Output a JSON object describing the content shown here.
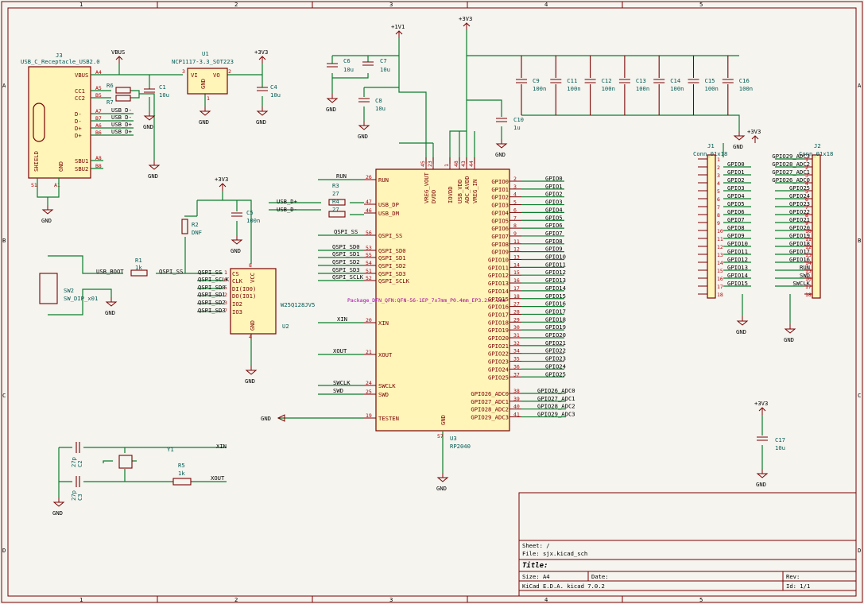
{
  "frame": {
    "cols": [
      "1",
      "2",
      "3",
      "4",
      "5"
    ],
    "rows": [
      "A",
      "B",
      "C",
      "D"
    ]
  },
  "title_block": {
    "sheet": "Sheet: /",
    "file": "File: sjx.kicad_sch",
    "title": "Title:",
    "size": "Size: A4",
    "date": "Date:",
    "rev": "Rev:",
    "tool": "KiCad E.D.A.  kicad 7.0.2",
    "id": "Id: 1/1"
  },
  "power": {
    "vbus": "VBUS",
    "v33": "+3V3",
    "v11": "+1V1",
    "gnd": "GND"
  },
  "j3": {
    "ref": "J3",
    "value": "USB_C_Receptacle_USB2.0",
    "pins_left": [
      "VBUS",
      "CC1",
      "CC2",
      "D-",
      "D-",
      "D+",
      "D+",
      "SBU1",
      "SBU2"
    ],
    "pins_num": [
      "A4",
      "A5",
      "B5",
      "A7",
      "B7",
      "A6",
      "B6",
      "A8",
      "B8"
    ],
    "shield": "SHIELD",
    "gnd": "GND",
    "s1": "S1",
    "a1": "A1",
    "net_dm": "USB_D-",
    "net_dp": "USB_D+"
  },
  "u1": {
    "ref": "U1",
    "value": "NCP1117-3.3_SOT223",
    "vi": "VI",
    "vo": "VO",
    "gnd": "GND",
    "p1": "1",
    "p2": "2",
    "p3": "3"
  },
  "parts": {
    "r6": "R6",
    "r7": "R7",
    "c1": "C1",
    "c1v": "10u",
    "c4": "C4",
    "c4v": "10u",
    "c6": "C6",
    "c6v": "10u",
    "c7": "C7",
    "c7v": "10u",
    "c8": "C8",
    "c8v": "10u",
    "c10": "C10",
    "c10v": "1u",
    "c5": "C5",
    "c5v": "100n",
    "r1": "R1",
    "r1v": "1k",
    "r2": "R2",
    "r2v": "DNF",
    "r3": "R3",
    "r3v": "27",
    "r4": "R4",
    "r4v": "27",
    "r5": "R5",
    "r5v": "1k",
    "sw2": "SW2",
    "sw2v": "SW_DIP_x01",
    "c2v": "27p",
    "c2": "C2",
    "c3v": "27p",
    "c3": "C3",
    "y1": "Y1",
    "c17": "C17",
    "c17v": "10u"
  },
  "caps_row": [
    {
      "ref": "C9",
      "val": "100n"
    },
    {
      "ref": "C11",
      "val": "100n"
    },
    {
      "ref": "C12",
      "val": "100n"
    },
    {
      "ref": "C13",
      "val": "100n"
    },
    {
      "ref": "C14",
      "val": "100n"
    },
    {
      "ref": "C15",
      "val": "100n"
    },
    {
      "ref": "C16",
      "val": "100n"
    }
  ],
  "u2": {
    "ref": "U2",
    "value": "W25Q128JV5",
    "pins": [
      "CS",
      "CLK",
      "DI(IO0)",
      "DO(IO1)",
      "IO2",
      "IO3"
    ],
    "nums": [
      "1",
      "6",
      "5",
      "2",
      "3",
      "7"
    ],
    "vcc": "VCC",
    "gnd": "GND",
    "p8": "8",
    "p4": "4",
    "nets": [
      "QSPI_SS",
      "QSPI_SCLK",
      "QSPI_SD0",
      "QSPI_SD1",
      "QSPI_SD2",
      "QSPI_SD3"
    ]
  },
  "u3": {
    "ref": "U3",
    "value": "RP2040",
    "footprint": "Package_DFN_QFN:QFN-56-1EP_7x7mm_P0.4mm_EP3.2x3.2mm",
    "left_pins": [
      {
        "n": "RUN",
        "num": "26"
      },
      {
        "n": "USB_DP",
        "num": "47"
      },
      {
        "n": "USB_DM",
        "num": "46"
      },
      {
        "n": "QSPI_SS",
        "num": "56"
      },
      {
        "n": "QSPI_SD0",
        "num": "53"
      },
      {
        "n": "QSPI_SD1",
        "num": "55"
      },
      {
        "n": "QSPI_SD2",
        "num": "54"
      },
      {
        "n": "QSPI_SD3",
        "num": "51"
      },
      {
        "n": "QSPI_SCLK",
        "num": "52"
      },
      {
        "n": "XIN",
        "num": "20"
      },
      {
        "n": "XOUT",
        "num": "21"
      },
      {
        "n": "SWCLK",
        "num": "24"
      },
      {
        "n": "SWD",
        "num": "25"
      },
      {
        "n": "TESTEN",
        "num": "19"
      }
    ],
    "top_pins": [
      {
        "n": "VREG_VOUT",
        "num": "45"
      },
      {
        "n": "DVDD",
        "num": "23"
      },
      {
        "n": "IOVDD",
        "num": "1"
      },
      {
        "n": "USB_VDD",
        "num": "48"
      },
      {
        "n": "ADC_AVDD",
        "num": "43"
      },
      {
        "n": "VREG_IN",
        "num": "44"
      }
    ],
    "gnd_pin": {
      "n": "GND",
      "num": "57"
    },
    "gpio": [
      {
        "n": "GPIO0",
        "num": "2"
      },
      {
        "n": "GPIO1",
        "num": "3"
      },
      {
        "n": "GPIO2",
        "num": "4"
      },
      {
        "n": "GPIO3",
        "num": "5"
      },
      {
        "n": "GPIO4",
        "num": "6"
      },
      {
        "n": "GPIO5",
        "num": "7"
      },
      {
        "n": "GPIO6",
        "num": "8"
      },
      {
        "n": "GPIO7",
        "num": "9"
      },
      {
        "n": "GPIO8",
        "num": "11"
      },
      {
        "n": "GPIO9",
        "num": "12"
      },
      {
        "n": "GPIO10",
        "num": "13"
      },
      {
        "n": "GPIO11",
        "num": "14"
      },
      {
        "n": "GPIO12",
        "num": "15"
      },
      {
        "n": "GPIO13",
        "num": "16"
      },
      {
        "n": "GPIO14",
        "num": "17"
      },
      {
        "n": "GPIO15",
        "num": "18"
      },
      {
        "n": "GPIO16",
        "num": "27"
      },
      {
        "n": "GPIO17",
        "num": "28"
      },
      {
        "n": "GPIO18",
        "num": "29"
      },
      {
        "n": "GPIO19",
        "num": "30"
      },
      {
        "n": "GPIO20",
        "num": "31"
      },
      {
        "n": "GPIO21",
        "num": "32"
      },
      {
        "n": "GPIO22",
        "num": "34"
      },
      {
        "n": "GPIO23",
        "num": "35"
      },
      {
        "n": "GPIO24",
        "num": "36"
      },
      {
        "n": "GPIO25",
        "num": "37"
      }
    ],
    "adc": [
      {
        "n": "GPIO26_ADC0",
        "num": "38"
      },
      {
        "n": "GPIO27_ADC1",
        "num": "39"
      },
      {
        "n": "GPIO28_ADC2",
        "num": "40"
      },
      {
        "n": "GPIO29_ADC3",
        "num": "41"
      }
    ]
  },
  "j1": {
    "ref": "J1",
    "value": "Conn_01x18",
    "nets": [
      "+3V3",
      "GPIO0",
      "GPIO1",
      "GPIO2",
      "GPIO3",
      "GPIO4",
      "GPIO5",
      "GPIO6",
      "GPIO7",
      "GPIO8",
      "GPIO9",
      "GPIO10",
      "GPIO11",
      "GPIO12",
      "GPIO13",
      "GPIO14",
      "GPIO15",
      "GND"
    ]
  },
  "j2": {
    "ref": "J2",
    "value": "Conn_01x18",
    "nets": [
      "GPIO29_ADC3",
      "GPIO28_ADC2",
      "GPIO27_ADC1",
      "GPIO26_ADC0",
      "GPIO25",
      "GPIO24",
      "GPIO23",
      "GPIO22",
      "GPIO21",
      "GPIO20",
      "GPIO19",
      "GPIO18",
      "GPIO17",
      "GPIO16",
      "RUN",
      "SWD",
      "SWCLK",
      "GND"
    ]
  },
  "nets": {
    "usb_dp": "USB_D+",
    "usb_dm": "USB_D-",
    "usb_boot": "USB_BOOT",
    "qspi_ss": "QSPI_SS",
    "run": "RUN",
    "xin": "XIN",
    "xout": "XOUT",
    "swclk": "SWCLK",
    "swd": "SWD",
    "qspi_sd0": "QSPI_SD0",
    "qspi_sd1": "QSPI_SD1",
    "qspi_sd2": "QSPI_SD2",
    "qspi_sd3": "QSPI_SD3",
    "qspi_sclk": "QSPI_SCLK"
  }
}
